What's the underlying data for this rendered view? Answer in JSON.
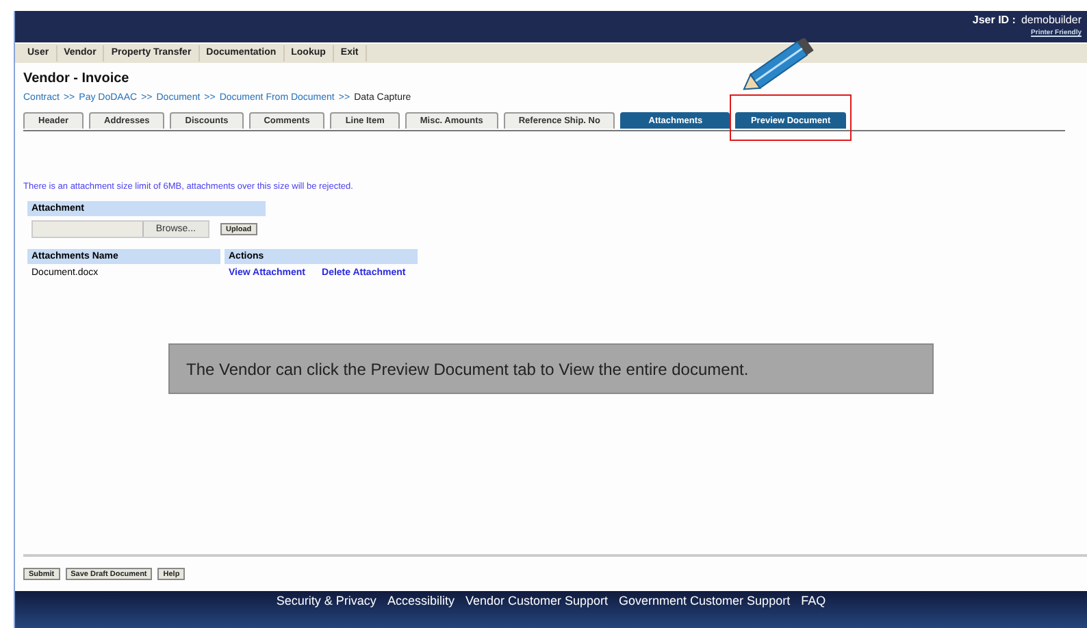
{
  "header": {
    "user_label": "Jser ID :",
    "user_id": "demobuilder",
    "printer_link": "Printer Friendly"
  },
  "menu": [
    "User",
    "Vendor",
    "Property Transfer",
    "Documentation",
    "Lookup",
    "Exit"
  ],
  "page_title": "Vendor - Invoice",
  "breadcrumb": [
    {
      "text": "Contract",
      "kind": "link"
    },
    {
      "text": ">>",
      "kind": "sep"
    },
    {
      "text": "Pay DoDAAC",
      "kind": "link"
    },
    {
      "text": ">>",
      "kind": "sep"
    },
    {
      "text": "Document",
      "kind": "link"
    },
    {
      "text": ">>",
      "kind": "sep"
    },
    {
      "text": "Document From Document",
      "kind": "link"
    },
    {
      "text": ">>",
      "kind": "sep"
    },
    {
      "text": "Data Capture",
      "kind": "current"
    }
  ],
  "tabs": [
    {
      "label": "Header",
      "selected": false,
      "highlighted": false
    },
    {
      "label": "Addresses",
      "selected": false,
      "highlighted": false
    },
    {
      "label": "Discounts",
      "selected": false,
      "highlighted": false
    },
    {
      "label": "Comments",
      "selected": false,
      "highlighted": false
    },
    {
      "label": "Line Item",
      "selected": false,
      "highlighted": false
    },
    {
      "label": "Misc. Amounts",
      "selected": false,
      "highlighted": false
    },
    {
      "label": "Reference Ship. No",
      "selected": false,
      "highlighted": false
    },
    {
      "label": "Attachments",
      "selected": true,
      "highlighted": false
    },
    {
      "label": "Preview Document",
      "selected": true,
      "highlighted": true
    }
  ],
  "notice": "There is an attachment size limit of 6MB, attachments over this size will be rejected.",
  "attachment": {
    "heading": "Attachment",
    "browse": "Browse...",
    "upload": "Upload"
  },
  "table": {
    "columns": [
      "Attachments Name",
      "Actions"
    ],
    "rows": [
      {
        "name": "Document.docx",
        "actions": [
          "View Attachment",
          "Delete Attachment"
        ]
      }
    ]
  },
  "callout": "The Vendor can click the Preview Document tab to View the entire document.",
  "buttons": [
    "Submit",
    "Save Draft Document",
    "Help"
  ],
  "footer": [
    "Security & Privacy",
    "Accessibility",
    "Vendor Customer Support",
    "Government Customer Support",
    "FAQ"
  ]
}
